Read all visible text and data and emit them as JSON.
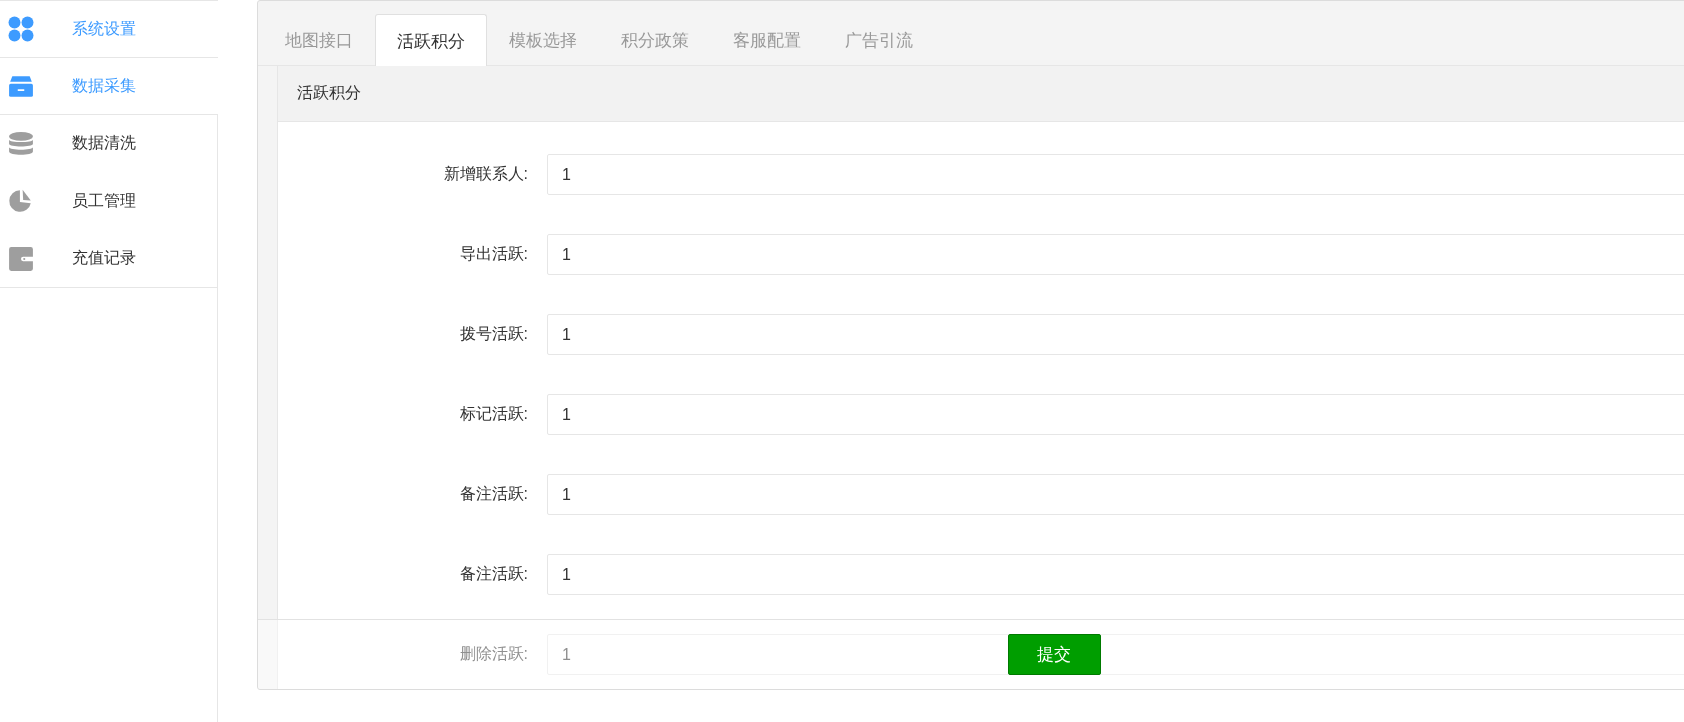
{
  "sidebar": {
    "items": [
      {
        "label": "系统设置",
        "highlighted": true
      },
      {
        "label": "数据采集",
        "highlighted": true
      },
      {
        "label": "数据清洗",
        "highlighted": false
      },
      {
        "label": "员工管理",
        "highlighted": false
      },
      {
        "label": "充值记录",
        "highlighted": false
      }
    ]
  },
  "tabs": [
    {
      "label": "地图接口",
      "selected": false
    },
    {
      "label": "活跃积分",
      "selected": true
    },
    {
      "label": "模板选择",
      "selected": false
    },
    {
      "label": "积分政策",
      "selected": false
    },
    {
      "label": "客服配置",
      "selected": false
    },
    {
      "label": "广告引流",
      "selected": false
    }
  ],
  "card": {
    "title": "活跃积分",
    "fields": [
      {
        "label": "新增联系人:",
        "value": "1"
      },
      {
        "label": "导出活跃:",
        "value": "1"
      },
      {
        "label": "拨号活跃:",
        "value": "1"
      },
      {
        "label": "标记活跃:",
        "value": "1"
      },
      {
        "label": "备注活跃:",
        "value": "1"
      },
      {
        "label": "备注活跃:",
        "value": "1"
      },
      {
        "label": "删除活跃:",
        "value": "1"
      }
    ]
  },
  "submit_button": "提交"
}
